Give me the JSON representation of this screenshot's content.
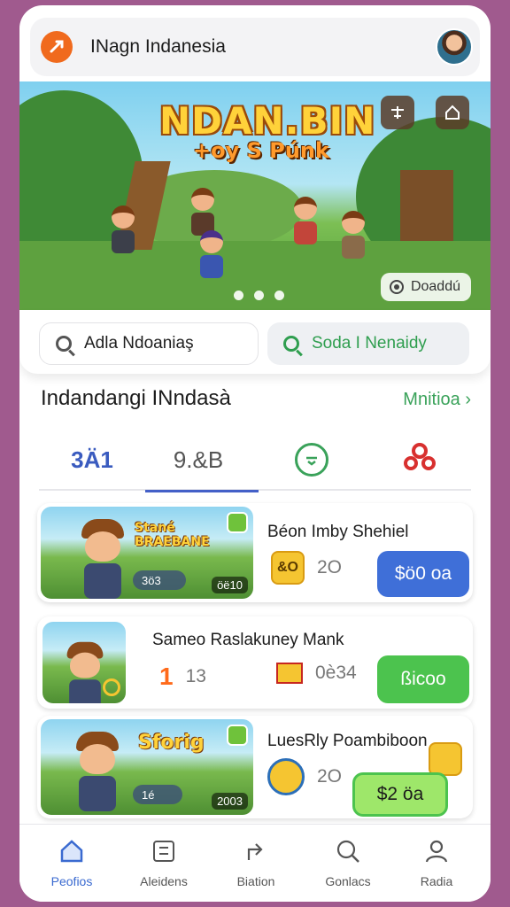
{
  "app": {
    "title": "INagn Indanesia",
    "icon": "app-logo-icon",
    "avatar": "user-avatar"
  },
  "banner": {
    "title": "NDAN.BIN",
    "subtitle": "+oy S Púnk",
    "download_label": "Doaddú",
    "top_buttons": [
      "calendar-icon",
      "home-icon"
    ],
    "carousel_dots": 3,
    "carousel_active": 0
  },
  "search": {
    "left_placeholder": "Adla Ndoaniaş",
    "right_placeholder": "Soda I Nenaidy"
  },
  "section": {
    "title": "Indandangi INndasà",
    "more_label": "Mnitioa"
  },
  "tabs": [
    {
      "label": "3Ä1",
      "icon": ""
    },
    {
      "label": "9.&B",
      "icon": ""
    },
    {
      "label": "",
      "icon": "shield-check-icon"
    },
    {
      "label": "",
      "icon": "link-icon"
    }
  ],
  "cards": [
    {
      "title": "Béon Imby Shehiel",
      "image_title": "Stané BRAEBANE",
      "image_pill": "3ö3",
      "image_tag": "öë10",
      "badge": "&O",
      "stat": "2O",
      "price": "$ö0 oa",
      "price_color": "#3f6fd8"
    },
    {
      "title": "Sameo Raslakuney Mank",
      "badge": "1",
      "stat": "13",
      "badge2": "0è34",
      "price": "ßicoo",
      "price_color": "#4cc34e"
    },
    {
      "title": "LuesRly Poambiboon",
      "image_title": "Sforig",
      "image_pill": "1é",
      "image_tag": "2003",
      "stat": "2O",
      "price": "$2 öa",
      "price_color": "#9ee76a"
    }
  ],
  "bottom_nav": [
    {
      "label": "Peofios",
      "icon": "home-icon",
      "active": true
    },
    {
      "label": "Aleidens",
      "icon": "grid-icon",
      "active": false
    },
    {
      "label": "Biation",
      "icon": "share-arrow-icon",
      "active": false
    },
    {
      "label": "Gonlacs",
      "icon": "search-icon",
      "active": false
    },
    {
      "label": "Radia",
      "icon": "profile-icon",
      "active": false
    }
  ]
}
